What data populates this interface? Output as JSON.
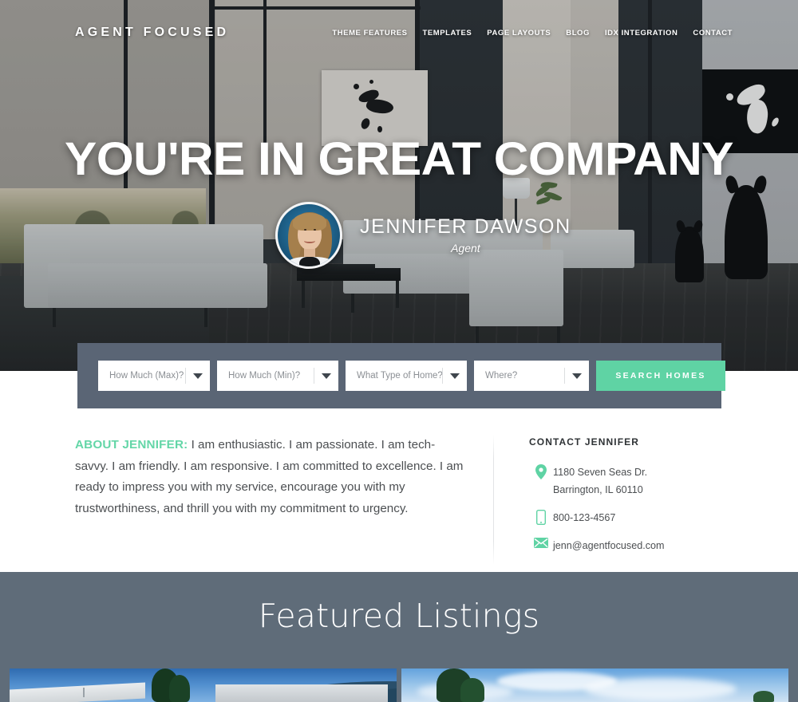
{
  "header": {
    "brand": "AGENT FOCUSED",
    "nav": [
      {
        "label": "THEME FEATURES"
      },
      {
        "label": "TEMPLATES"
      },
      {
        "label": "PAGE LAYOUTS"
      },
      {
        "label": "BLOG"
      },
      {
        "label": "IDX INTEGRATION"
      },
      {
        "label": "CONTACT"
      }
    ]
  },
  "hero": {
    "title": "YOU'RE IN GREAT COMPANY",
    "agent_name": "JENNIFER DAWSON",
    "agent_role": "Agent"
  },
  "search": {
    "fields": [
      {
        "placeholder": "How Much (Max)?",
        "name": "price-max-select"
      },
      {
        "placeholder": "How Much (Min)?",
        "name": "price-min-select"
      },
      {
        "placeholder": "What Type of Home?",
        "name": "home-type-select"
      },
      {
        "placeholder": "Where?",
        "name": "location-select"
      }
    ],
    "button_label": "SEARCH HOMES"
  },
  "about": {
    "lead": "ABOUT JENNIFER:",
    "body": " I am enthusiastic. I am passionate. I am tech-savvy. I am friendly. I am responsive. I am committed to excellence. I am ready to impress you with my service, encourage you with my trustworthiness, and thrill you with my commitment to urgency."
  },
  "contact": {
    "title": "CONTACT JENNIFER",
    "address_line1": "1180 Seven Seas Dr.",
    "address_line2": "Barrington, IL 60110",
    "phone": "800-123-4567",
    "email": "jenn@agentfocused.com"
  },
  "featured": {
    "title": "Featured Listings"
  },
  "colors": {
    "accent_green": "#5fd3a4",
    "slate": "#5f6c79",
    "search_bar": "#5a6575",
    "body_text": "#4c4f52"
  }
}
